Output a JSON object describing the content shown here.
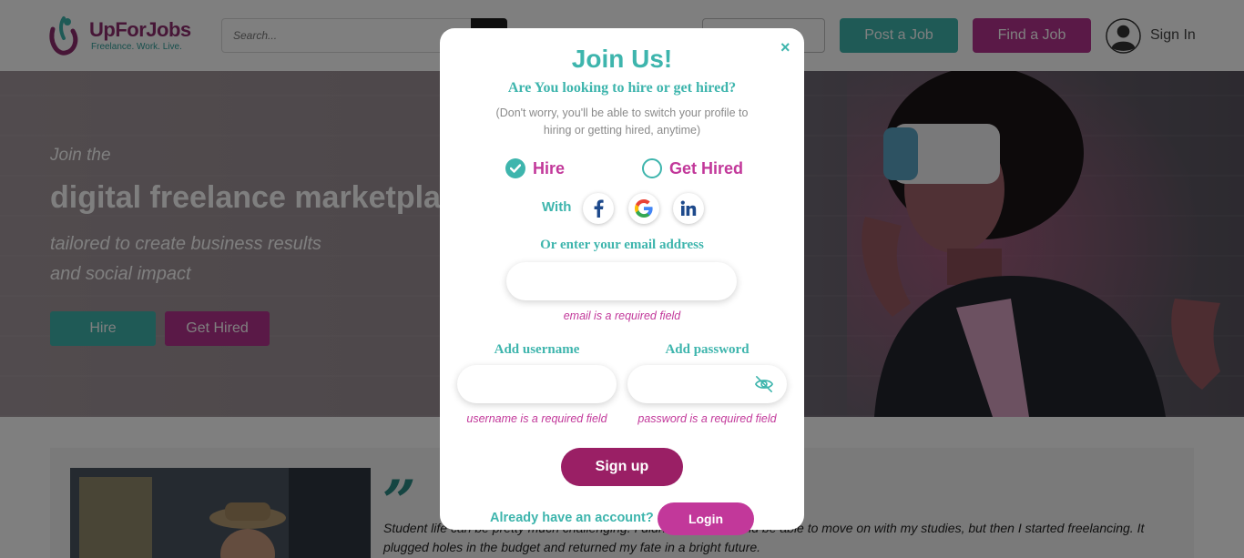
{
  "header": {
    "logo_name": "UpForJobs",
    "logo_tagline": "Freelance. Work. Live.",
    "search_placeholder": "Search...",
    "post_job_label": "Post a Job",
    "find_job_label": "Find a Job",
    "sign_in_label": "Sign In"
  },
  "hero": {
    "intro": "Join the",
    "title": "digital freelance marketplace",
    "subtitle_line1": "tailored to create business results",
    "subtitle_line2": "and social impact",
    "hire_label": "Hire",
    "get_hired_label": "Get Hired"
  },
  "testimonial": {
    "quote_mark": "”",
    "text": "Student life can be pretty much challenging. I didn't know if I would be able to move on with my studies, but then I started freelancing. It plugged holes in the budget and returned my fate in a bright future."
  },
  "modal": {
    "close": "×",
    "title": "Join Us!",
    "question": "Are You looking to hire or get hired?",
    "note": "(Don't worry, you'll be able to switch your profile to hiring or getting hired, anytime)",
    "options": [
      {
        "label": "Hire",
        "selected": true
      },
      {
        "label": "Get Hired",
        "selected": false
      }
    ],
    "with_label": "With",
    "social": [
      "facebook-icon",
      "google-icon",
      "linkedin-icon"
    ],
    "or_email_label": "Or enter your email address",
    "email_value": "",
    "email_error": "email is a required field",
    "username_label": "Add username",
    "username_value": "",
    "username_error": "username is a required field",
    "password_label": "Add password",
    "password_value": "",
    "password_error": "password is a required field",
    "signup_label": "Sign up",
    "have_account_label": "Already have an account?",
    "login_label": "Login"
  },
  "colors": {
    "teal": "#3eb5ad",
    "magenta": "#c2389a",
    "plum": "#9a1f65"
  }
}
